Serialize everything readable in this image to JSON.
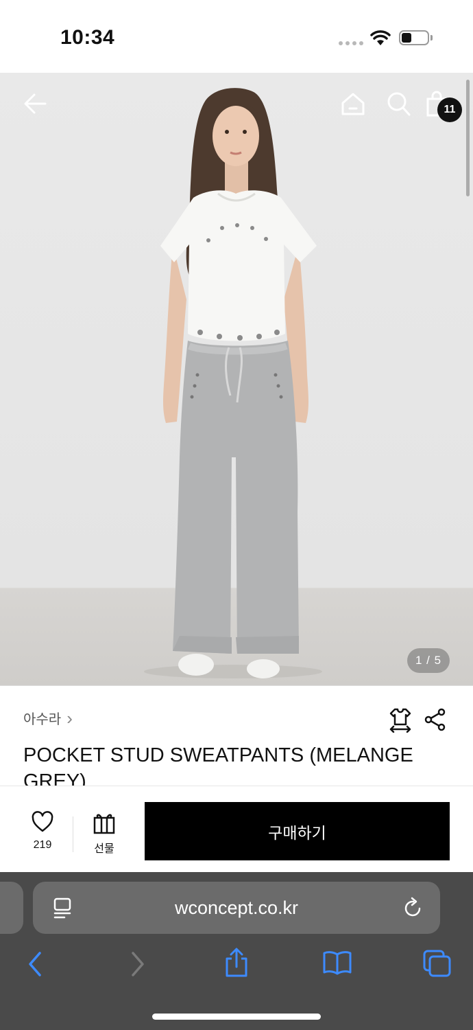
{
  "status_bar": {
    "time": "10:34"
  },
  "header": {
    "cart_count": "11"
  },
  "gallery": {
    "pager": "1 / 5"
  },
  "product": {
    "brand": "아수라",
    "brand_chevron": "›",
    "title": "POCKET STUD SWEATPANTS (MELANGE GREY)"
  },
  "actions": {
    "like_count": "219",
    "gift_label": "선물",
    "buy_label": "구매하기"
  },
  "browser": {
    "url": "wconcept.co.kr"
  },
  "colors": {
    "buy_button": "#000000",
    "browser_chrome": "#4a4a4a",
    "url_bar": "#6b6b6b",
    "toolbar_icon": "#3d8bff"
  }
}
